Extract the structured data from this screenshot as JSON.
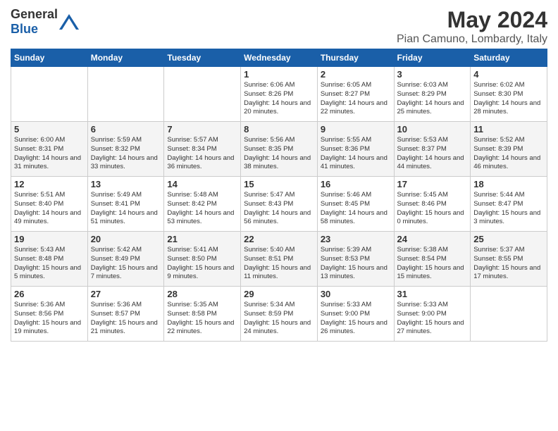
{
  "header": {
    "logo_general": "General",
    "logo_blue": "Blue",
    "title": "May 2024",
    "subtitle": "Pian Camuno, Lombardy, Italy"
  },
  "days_of_week": [
    "Sunday",
    "Monday",
    "Tuesday",
    "Wednesday",
    "Thursday",
    "Friday",
    "Saturday"
  ],
  "weeks": [
    [
      {
        "day": "",
        "info": ""
      },
      {
        "day": "",
        "info": ""
      },
      {
        "day": "",
        "info": ""
      },
      {
        "day": "1",
        "info": "Sunrise: 6:06 AM\nSunset: 8:26 PM\nDaylight: 14 hours\nand 20 minutes."
      },
      {
        "day": "2",
        "info": "Sunrise: 6:05 AM\nSunset: 8:27 PM\nDaylight: 14 hours\nand 22 minutes."
      },
      {
        "day": "3",
        "info": "Sunrise: 6:03 AM\nSunset: 8:29 PM\nDaylight: 14 hours\nand 25 minutes."
      },
      {
        "day": "4",
        "info": "Sunrise: 6:02 AM\nSunset: 8:30 PM\nDaylight: 14 hours\nand 28 minutes."
      }
    ],
    [
      {
        "day": "5",
        "info": "Sunrise: 6:00 AM\nSunset: 8:31 PM\nDaylight: 14 hours\nand 31 minutes."
      },
      {
        "day": "6",
        "info": "Sunrise: 5:59 AM\nSunset: 8:32 PM\nDaylight: 14 hours\nand 33 minutes."
      },
      {
        "day": "7",
        "info": "Sunrise: 5:57 AM\nSunset: 8:34 PM\nDaylight: 14 hours\nand 36 minutes."
      },
      {
        "day": "8",
        "info": "Sunrise: 5:56 AM\nSunset: 8:35 PM\nDaylight: 14 hours\nand 38 minutes."
      },
      {
        "day": "9",
        "info": "Sunrise: 5:55 AM\nSunset: 8:36 PM\nDaylight: 14 hours\nand 41 minutes."
      },
      {
        "day": "10",
        "info": "Sunrise: 5:53 AM\nSunset: 8:37 PM\nDaylight: 14 hours\nand 44 minutes."
      },
      {
        "day": "11",
        "info": "Sunrise: 5:52 AM\nSunset: 8:39 PM\nDaylight: 14 hours\nand 46 minutes."
      }
    ],
    [
      {
        "day": "12",
        "info": "Sunrise: 5:51 AM\nSunset: 8:40 PM\nDaylight: 14 hours\nand 49 minutes."
      },
      {
        "day": "13",
        "info": "Sunrise: 5:49 AM\nSunset: 8:41 PM\nDaylight: 14 hours\nand 51 minutes."
      },
      {
        "day": "14",
        "info": "Sunrise: 5:48 AM\nSunset: 8:42 PM\nDaylight: 14 hours\nand 53 minutes."
      },
      {
        "day": "15",
        "info": "Sunrise: 5:47 AM\nSunset: 8:43 PM\nDaylight: 14 hours\nand 56 minutes."
      },
      {
        "day": "16",
        "info": "Sunrise: 5:46 AM\nSunset: 8:45 PM\nDaylight: 14 hours\nand 58 minutes."
      },
      {
        "day": "17",
        "info": "Sunrise: 5:45 AM\nSunset: 8:46 PM\nDaylight: 15 hours\nand 0 minutes."
      },
      {
        "day": "18",
        "info": "Sunrise: 5:44 AM\nSunset: 8:47 PM\nDaylight: 15 hours\nand 3 minutes."
      }
    ],
    [
      {
        "day": "19",
        "info": "Sunrise: 5:43 AM\nSunset: 8:48 PM\nDaylight: 15 hours\nand 5 minutes."
      },
      {
        "day": "20",
        "info": "Sunrise: 5:42 AM\nSunset: 8:49 PM\nDaylight: 15 hours\nand 7 minutes."
      },
      {
        "day": "21",
        "info": "Sunrise: 5:41 AM\nSunset: 8:50 PM\nDaylight: 15 hours\nand 9 minutes."
      },
      {
        "day": "22",
        "info": "Sunrise: 5:40 AM\nSunset: 8:51 PM\nDaylight: 15 hours\nand 11 minutes."
      },
      {
        "day": "23",
        "info": "Sunrise: 5:39 AM\nSunset: 8:53 PM\nDaylight: 15 hours\nand 13 minutes."
      },
      {
        "day": "24",
        "info": "Sunrise: 5:38 AM\nSunset: 8:54 PM\nDaylight: 15 hours\nand 15 minutes."
      },
      {
        "day": "25",
        "info": "Sunrise: 5:37 AM\nSunset: 8:55 PM\nDaylight: 15 hours\nand 17 minutes."
      }
    ],
    [
      {
        "day": "26",
        "info": "Sunrise: 5:36 AM\nSunset: 8:56 PM\nDaylight: 15 hours\nand 19 minutes."
      },
      {
        "day": "27",
        "info": "Sunrise: 5:36 AM\nSunset: 8:57 PM\nDaylight: 15 hours\nand 21 minutes."
      },
      {
        "day": "28",
        "info": "Sunrise: 5:35 AM\nSunset: 8:58 PM\nDaylight: 15 hours\nand 22 minutes."
      },
      {
        "day": "29",
        "info": "Sunrise: 5:34 AM\nSunset: 8:59 PM\nDaylight: 15 hours\nand 24 minutes."
      },
      {
        "day": "30",
        "info": "Sunrise: 5:33 AM\nSunset: 9:00 PM\nDaylight: 15 hours\nand 26 minutes."
      },
      {
        "day": "31",
        "info": "Sunrise: 5:33 AM\nSunset: 9:00 PM\nDaylight: 15 hours\nand 27 minutes."
      },
      {
        "day": "",
        "info": ""
      }
    ]
  ]
}
